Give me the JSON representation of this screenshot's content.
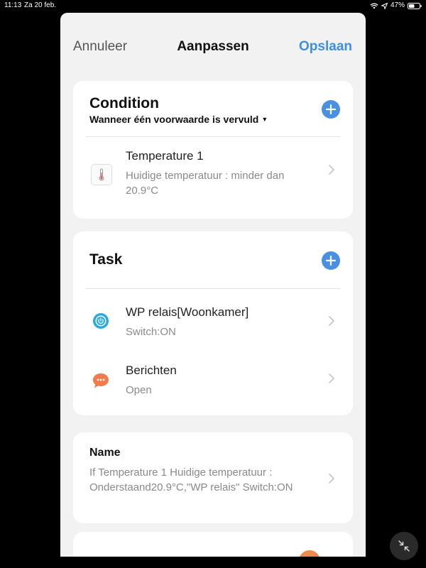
{
  "status_bar": {
    "time": "11:13",
    "date": "Za 20 feb.",
    "battery": "47%"
  },
  "nav": {
    "cancel": "Annuleer",
    "title": "Aanpassen",
    "save": "Opslaan"
  },
  "condition": {
    "title": "Condition",
    "mode": "Wanneer één voorwaarde is vervuld",
    "items": [
      {
        "title": "Temperature 1",
        "subtitle": "Huidige temperatuur : minder dan 20.9°C",
        "icon": "thermometer-icon"
      }
    ]
  },
  "task": {
    "title": "Task",
    "items": [
      {
        "title": "WP relais[Woonkamer]",
        "subtitle": "Switch:ON",
        "icon": "power-icon"
      },
      {
        "title": "Berichten",
        "subtitle": "Open",
        "icon": "message-icon"
      }
    ]
  },
  "name": {
    "label": "Name",
    "value": "If Temperature 1 Huidige temperatuur : Onderstaand20.9°C,\"WP relais\" Switch:ON"
  },
  "colors": {
    "accent": "#3d8ee8",
    "plus": "#4a90e2",
    "power": "#29a9e0",
    "message": "#f07c4e"
  }
}
